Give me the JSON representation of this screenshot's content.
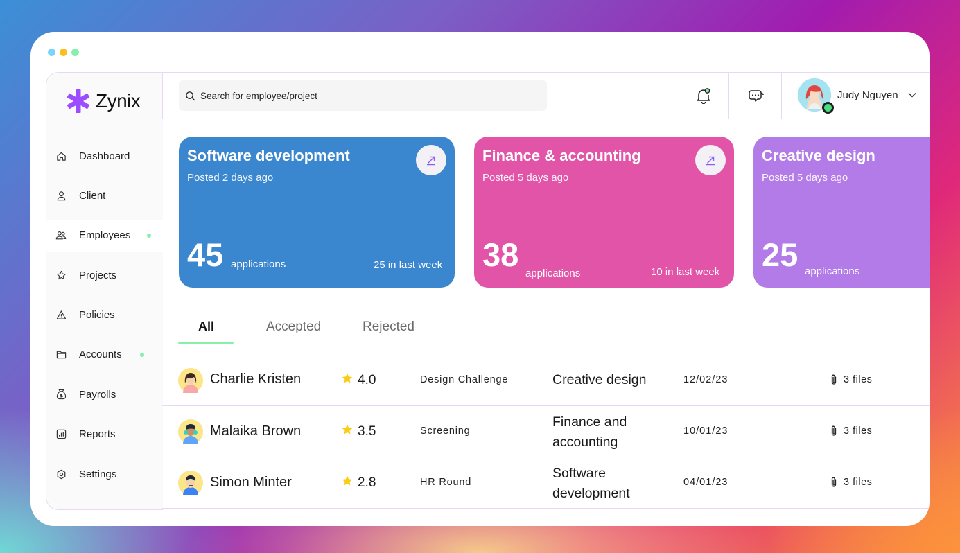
{
  "window": {
    "dots": [
      "#7dd3fc",
      "#fbbf24",
      "#86efac"
    ]
  },
  "brand": {
    "name": "Zynix",
    "accent": "#9b4dff"
  },
  "sidebar": {
    "items": [
      {
        "label": "Dashboard",
        "icon": "home-icon",
        "active": false,
        "dot": false
      },
      {
        "label": "Client",
        "icon": "user-icon",
        "active": false,
        "dot": false
      },
      {
        "label": "Employees",
        "icon": "users-icon",
        "active": true,
        "dot": true
      },
      {
        "label": "Projects",
        "icon": "star-outline-icon",
        "active": false,
        "dot": false
      },
      {
        "label": "Policies",
        "icon": "warning-icon",
        "active": false,
        "dot": false
      },
      {
        "label": "Accounts",
        "icon": "folder-icon",
        "active": false,
        "dot": true
      },
      {
        "label": "Payrolls",
        "icon": "money-bag-icon",
        "active": false,
        "dot": false
      },
      {
        "label": "Reports",
        "icon": "chart-icon",
        "active": false,
        "dot": false
      },
      {
        "label": "Settings",
        "icon": "gear-icon",
        "active": false,
        "dot": false
      }
    ]
  },
  "topbar": {
    "search_placeholder": "Search for employee/project",
    "user_name": "Judy Nguyen"
  },
  "cards": [
    {
      "title": "Software development",
      "posted": "Posted 2 days ago",
      "count": "45",
      "apps_label": "applications",
      "week": "25 in last week",
      "color": "#3b87cf"
    },
    {
      "title": "Finance & accounting",
      "posted": "Posted 5 days ago",
      "count": "38",
      "apps_label": "applications",
      "week": "10 in last week",
      "color": "#e254a8"
    },
    {
      "title": "Creative design",
      "posted": "Posted 5 days ago",
      "count": "25",
      "apps_label": "applications",
      "week": "",
      "color": "#b27be8"
    }
  ],
  "tabs": [
    "All",
    "Accepted",
    "Rejected"
  ],
  "rows": [
    {
      "name": "Charlie Kristen",
      "rating": "4.0",
      "stage": "Design Challenge",
      "dept": "Creative design",
      "date": "12/02/23",
      "files": "3 files"
    },
    {
      "name": "Malaika Brown",
      "rating": "3.5",
      "stage": "Screening",
      "dept": "Finance and accounting",
      "date": "10/01/23",
      "files": "3 files"
    },
    {
      "name": "Simon Minter",
      "rating": "2.8",
      "stage": "HR Round",
      "dept": "Software development",
      "date": "04/01/23",
      "files": "3 files"
    }
  ]
}
